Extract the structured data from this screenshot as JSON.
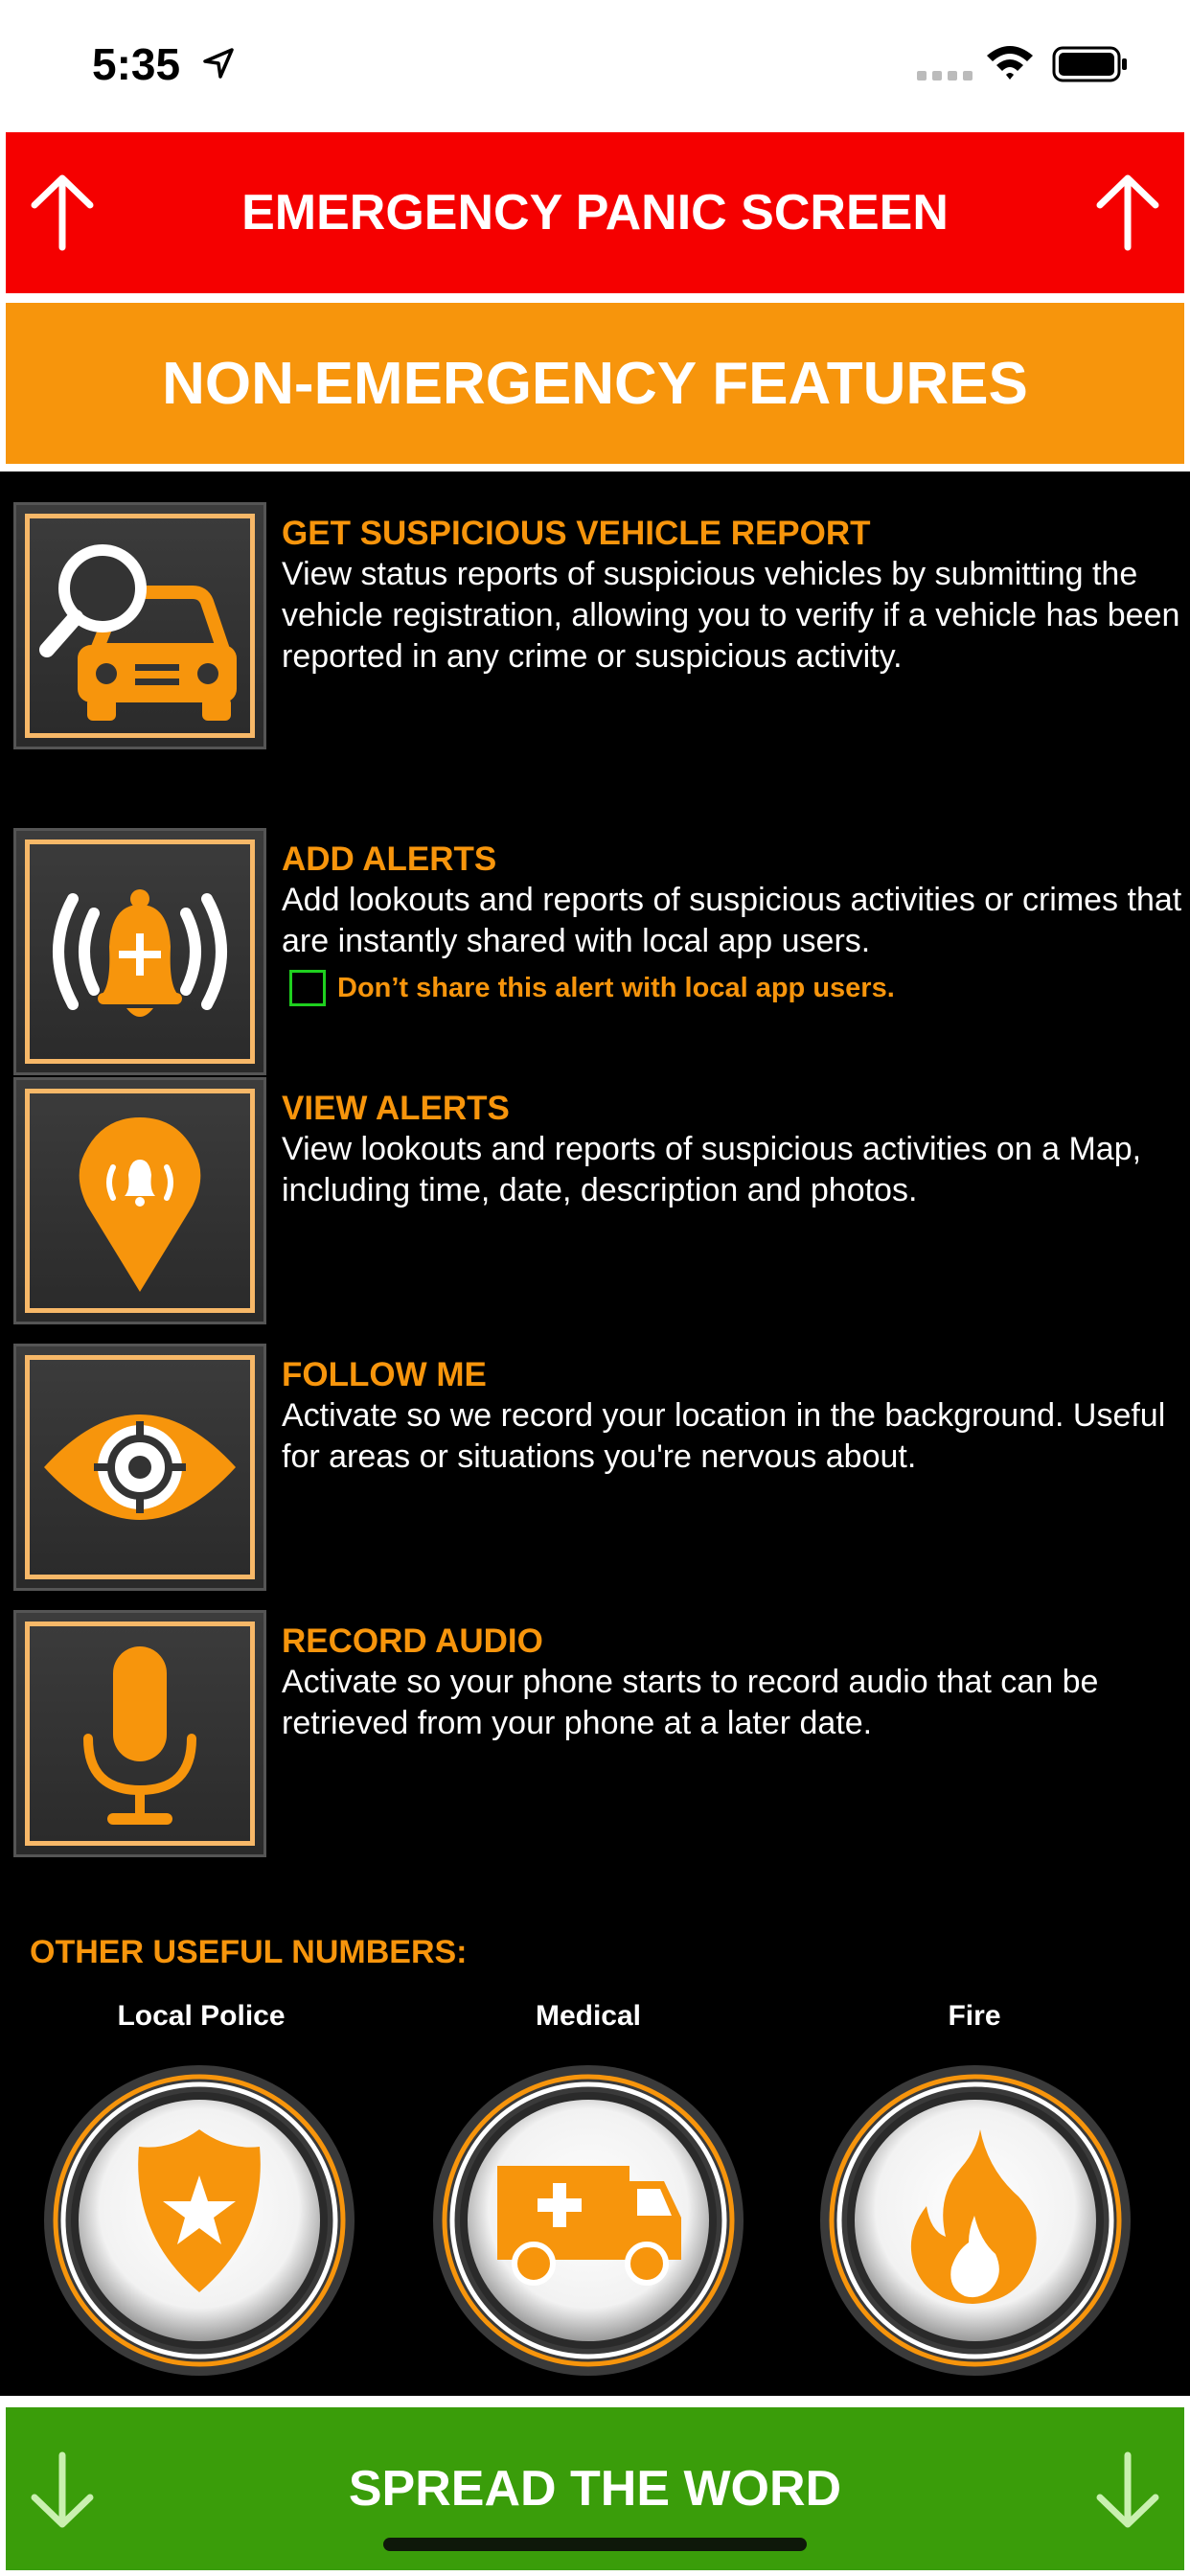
{
  "status_bar": {
    "time": "5:35"
  },
  "banners": {
    "emergency": "EMERGENCY PANIC SCREEN",
    "non_emergency": "NON-EMERGENCY FEATURES",
    "spread": "SPREAD THE WORD"
  },
  "features": [
    {
      "title": "GET SUSPICIOUS VEHICLE REPORT",
      "description": "View status reports of suspicious vehicles by submitting the vehicle registration, allowing you to verify if a vehicle has been reported in any crime or suspicious activity.",
      "icon": "car-search-icon"
    },
    {
      "title": "ADD ALERTS",
      "description": "Add lookouts and reports of suspicious activities or crimes that are instantly shared with local app users.",
      "icon": "alert-bell-add-icon"
    },
    {
      "title": "VIEW ALERTS",
      "description": "View lookouts and reports of suspicious activities on a Map, including time, date, description and photos.",
      "icon": "map-pin-bell-icon"
    },
    {
      "title": "FOLLOW ME",
      "description": "Activate so we record your location in the background. Useful for areas or situations you're nervous about.",
      "icon": "eye-target-icon"
    },
    {
      "title": "RECORD AUDIO",
      "description": "Activate so your phone starts to record audio that can be retrieved from your phone at a later date.",
      "icon": "microphone-icon"
    }
  ],
  "share_option": {
    "label": "Don’t share this alert with local app users.",
    "checked": false
  },
  "useful_numbers": {
    "title": "OTHER USEFUL NUMBERS:",
    "items": [
      {
        "label": "Local Police",
        "icon": "police-badge-icon"
      },
      {
        "label": "Medical",
        "icon": "ambulance-icon"
      },
      {
        "label": "Fire",
        "icon": "fire-icon"
      }
    ]
  },
  "colors": {
    "red": "#f50000",
    "orange": "#f7950c",
    "green": "#3a9d0a",
    "black": "#000000"
  }
}
